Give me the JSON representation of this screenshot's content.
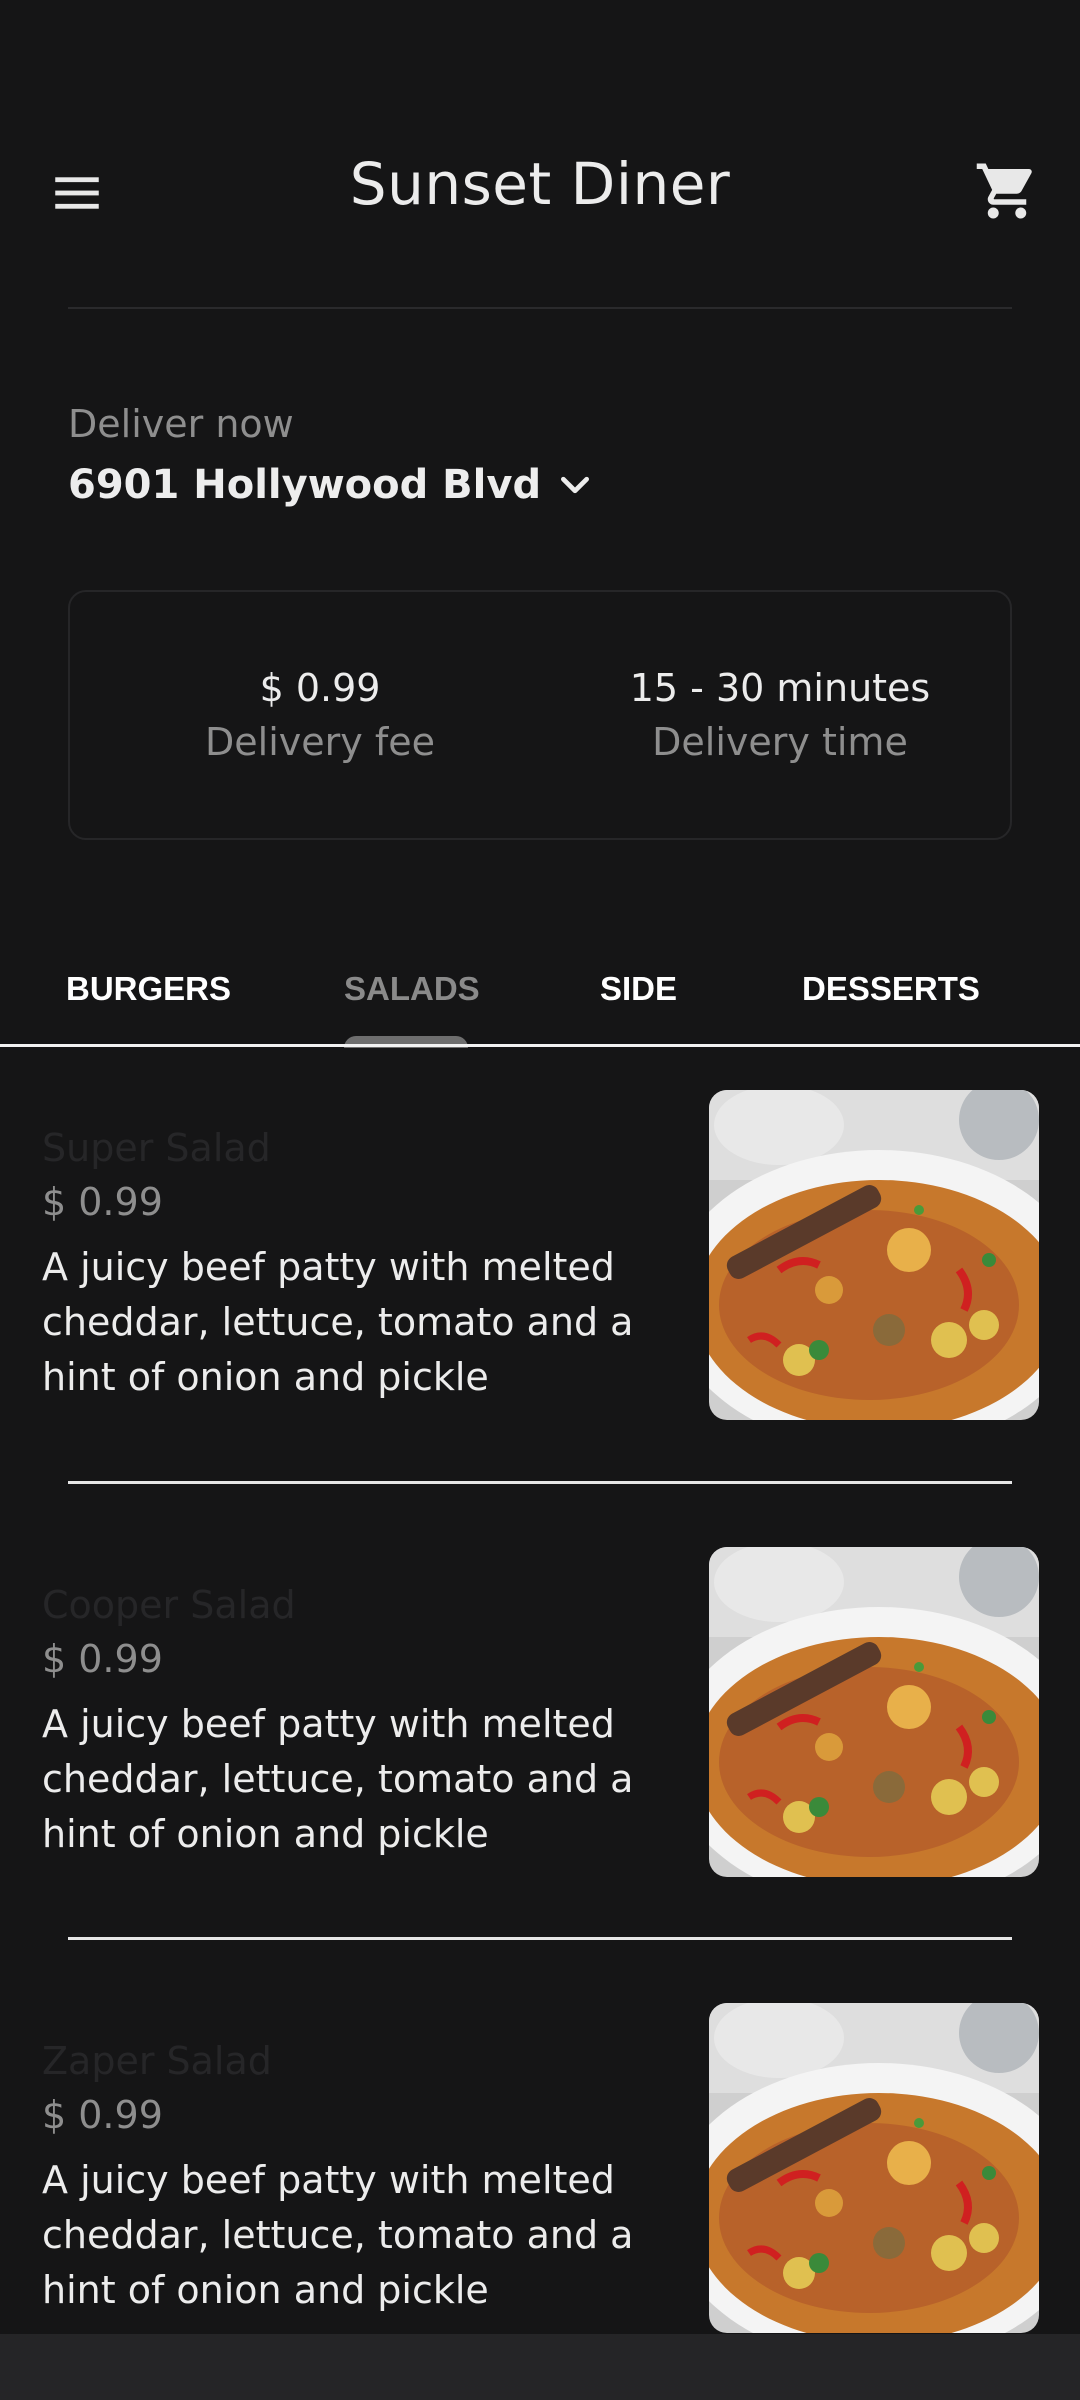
{
  "header": {
    "title": "Sunset Diner",
    "menu_icon": "hamburger-menu-icon",
    "cart_icon": "shopping-cart-icon"
  },
  "delivery": {
    "label": "Deliver now",
    "address": "6901 Hollywood Blvd",
    "dropdown_icon": "chevron-down-icon"
  },
  "info": {
    "fee_value": "$ 0.99",
    "fee_label": "Delivery fee",
    "time_value": "15 - 30 minutes",
    "time_label": "Delivery time"
  },
  "tabs": [
    {
      "label": "BURGERS",
      "active": false
    },
    {
      "label": "SALADS",
      "active": true
    },
    {
      "label": "SIDE",
      "active": false
    },
    {
      "label": "DESSERTS",
      "active": false
    }
  ],
  "items": [
    {
      "name": "Super Salad",
      "price": "$ 0.99",
      "description": "A juicy beef patty with melted cheddar, lettuce, tomato and a hint of onion and pickle"
    },
    {
      "name": "Cooper Salad",
      "price": "$ 0.99",
      "description": "A juicy beef patty with melted cheddar, lettuce, tomato and a hint of onion and pickle"
    },
    {
      "name": "Zaper Salad",
      "price": "$ 0.99",
      "description": "A juicy beef patty with melted cheddar, lettuce, tomato and a hint of onion and pickle"
    }
  ],
  "colors": {
    "background": "#151516",
    "text_primary": "#ececec",
    "text_secondary": "#8e8e8e",
    "tab_indicator": "#6e6e6e"
  }
}
